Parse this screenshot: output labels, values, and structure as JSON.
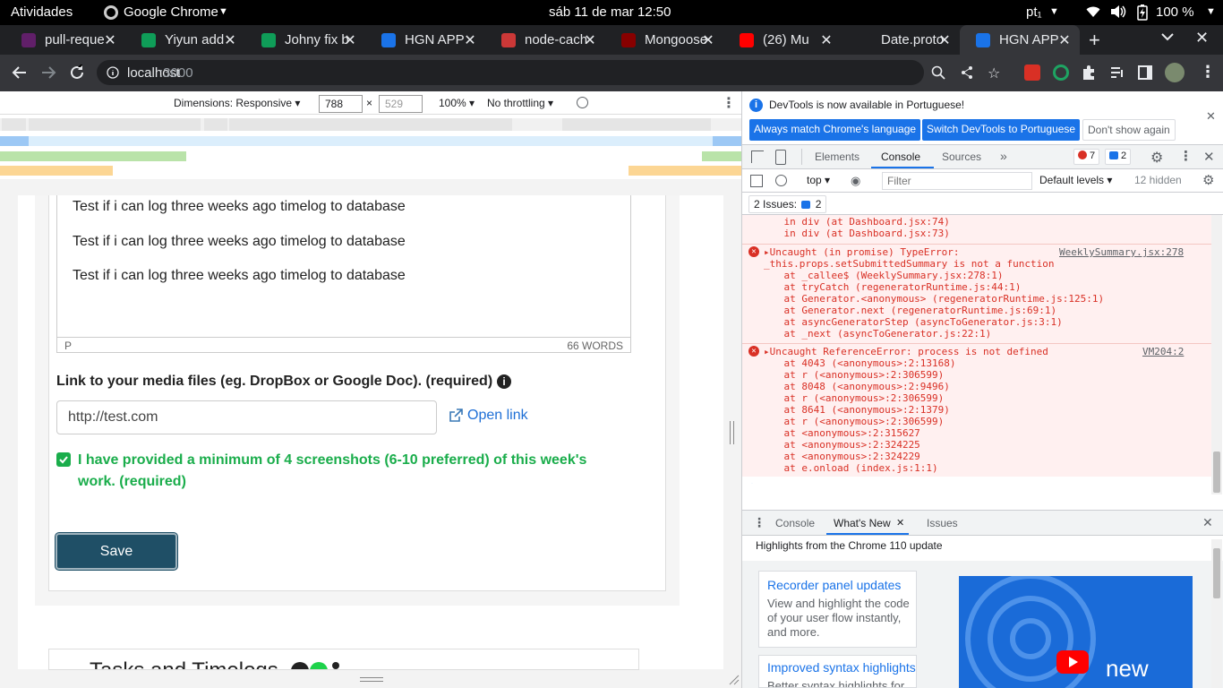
{
  "system": {
    "activities": "Atividades",
    "app_name": "Google Chrome",
    "clock": "sáb 11 de mar  12:50",
    "keyboard": "pt₁",
    "battery": "100 %"
  },
  "tabs": [
    {
      "label": "pull-reque",
      "color": "#611f69"
    },
    {
      "label": "Yiyun add",
      "color": "#0f9d58"
    },
    {
      "label": "Johny fix b",
      "color": "#0f9d58"
    },
    {
      "label": "HGN APP",
      "color": "#1a73e8"
    },
    {
      "label": "node-cach",
      "color": "#cb3837"
    },
    {
      "label": "Mongoose",
      "color": "#880000"
    },
    {
      "label": "(26) Mu",
      "color": "#ff0000"
    },
    {
      "label": "Date.proto",
      "color": "#202124"
    },
    {
      "label": "HGN APP",
      "color": "#1a73e8"
    }
  ],
  "address": {
    "host": "localhost",
    "port": ":3000"
  },
  "device_toolbar": {
    "dimensions": "Dimensions: Responsive ▾",
    "width": "788",
    "times": "×",
    "height": "529",
    "zoom": "100% ▾",
    "throttle": "No throttling ▾"
  },
  "page": {
    "editor_lines": [
      "Test if i can log three weeks ago timelog to database",
      "Test if i can log three weeks ago timelog to database",
      "Test if i can log three weeks ago timelog to database"
    ],
    "editor_status_path": "P",
    "editor_word_count": "66 WORDS",
    "media_label": "Link to your media files (eg. DropBox or Google Doc). (required)",
    "media_value": "http://test.com",
    "open_link": "Open link",
    "checkbox_label": "I have provided a minimum of 4 screenshots (6-10 preferred) of this week's work. (required)",
    "checkbox_checked": true,
    "save": "Save",
    "tasks_title": "Tasks and Timelogs"
  },
  "devtools": {
    "infobar": "DevTools is now available in Portuguese!",
    "btn_match": "Always match Chrome's language",
    "btn_switch": "Switch DevTools to Portuguese",
    "btn_dont": "Don't show again",
    "tabs": [
      "Elements",
      "Console",
      "Sources"
    ],
    "active_tab": "Console",
    "error_count": "7",
    "issue_count": "2",
    "context": "top ▾",
    "filter_placeholder": "Filter",
    "levels": "Default levels ▾",
    "hidden": "12 hidden",
    "issues_bar": "2 Issues:",
    "issues_bar_count": "2",
    "pre_lines": [
      "    in div (at Dashboard.jsx:74)",
      "    in div (at Dashboard.jsx:73)"
    ],
    "error1": {
      "head": "Uncaught (in promise) TypeError:",
      "head2": "_this.props.setSubmittedSummary is not a function",
      "source": "WeeklySummary.jsx:278",
      "stack": [
        "    at _callee$ (WeeklySummary.jsx:278:1)",
        "    at tryCatch (regeneratorRuntime.js:44:1)",
        "    at Generator.<anonymous> (regeneratorRuntime.js:125:1)",
        "    at Generator.next (regeneratorRuntime.js:69:1)",
        "    at asyncGeneratorStep (asyncToGenerator.js:3:1)",
        "    at _next (asyncToGenerator.js:22:1)"
      ]
    },
    "error2": {
      "head": "Uncaught ReferenceError: process is not defined",
      "source": "VM204:2",
      "stack": [
        "    at 4043 (<anonymous>:2:13168)",
        "    at r (<anonymous>:2:306599)",
        "    at 8048 (<anonymous>:2:9496)",
        "    at r (<anonymous>:2:306599)",
        "    at 8641 (<anonymous>:2:1379)",
        "    at r (<anonymous>:2:306599)",
        "    at <anonymous>:2:315627",
        "    at <anonymous>:2:324225",
        "    at <anonymous>:2:324229",
        "    at e.onload (index.js:1:1)"
      ]
    },
    "prompt": "›",
    "drawer_tabs": [
      "Console",
      "What's New",
      "Issues"
    ],
    "drawer_active": "What's New",
    "whatsnew_title": "Highlights from the Chrome 110 update",
    "card1_title": "Recorder panel updates",
    "card1_body": "View and highlight the code of your user flow instantly, and more.",
    "card2_title": "Improved syntax highlights",
    "card2_body": "Better syntax highlights for",
    "video_text": "new"
  }
}
